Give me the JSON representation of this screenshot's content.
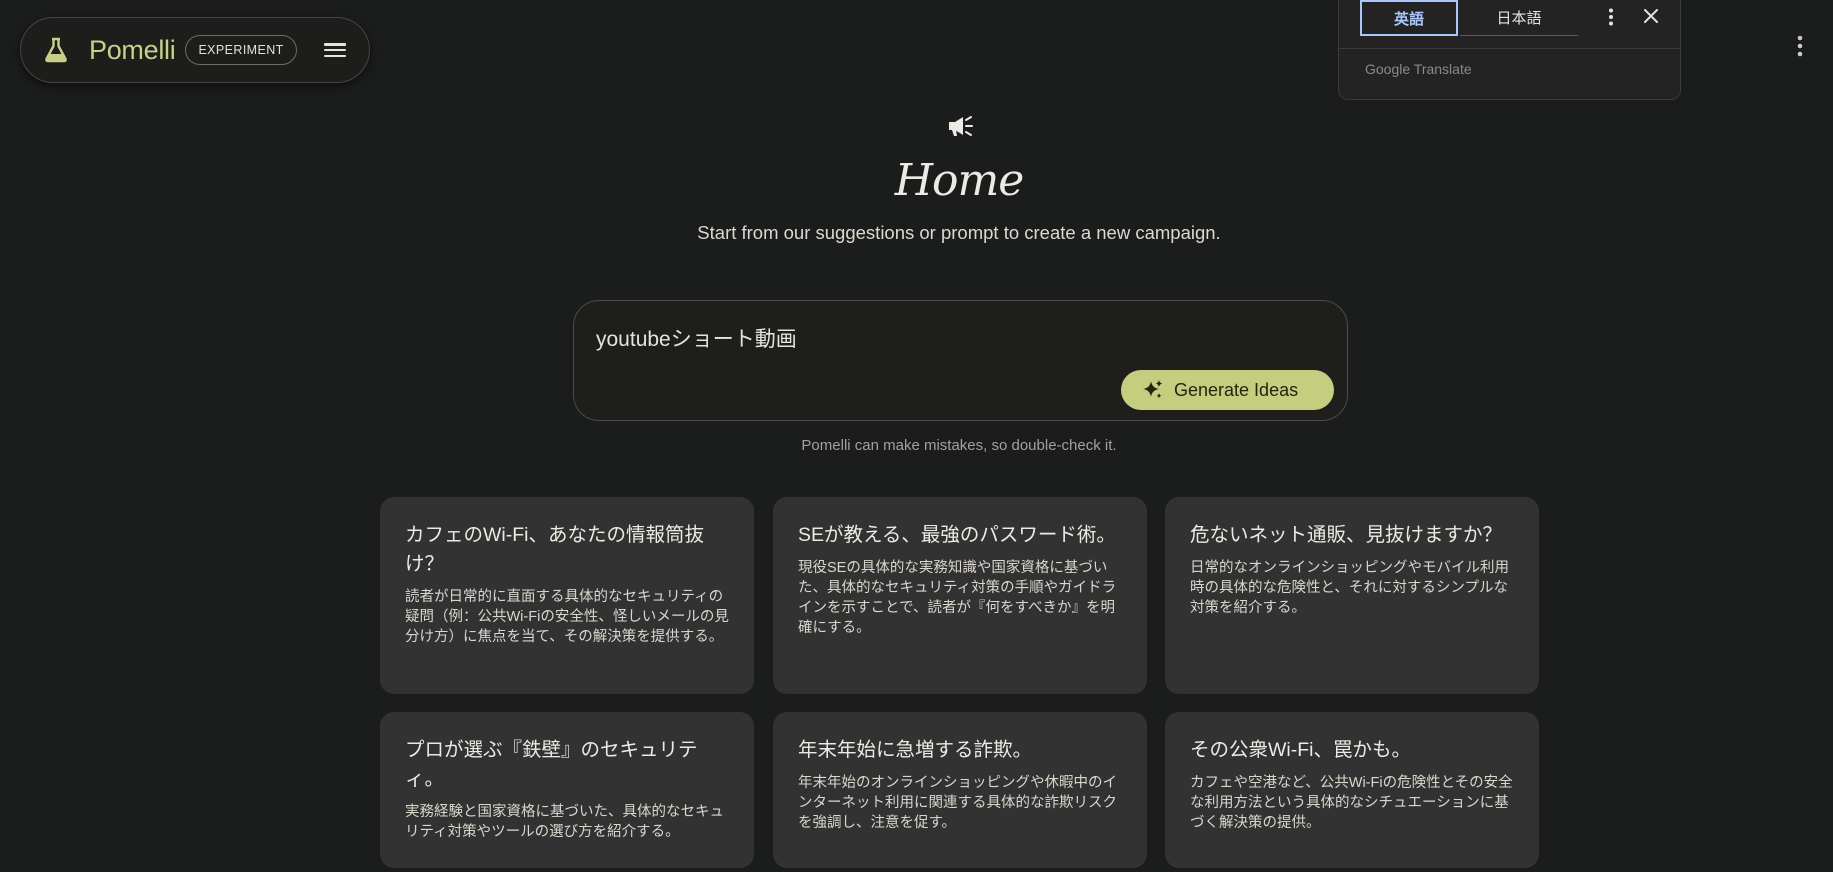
{
  "header": {
    "brand_name": "Pomelli",
    "badge": "EXPERIMENT",
    "icons": {
      "logo": "flask-icon",
      "menu": "hamburger-menu-icon",
      "overflow": "more-vertical-icon"
    }
  },
  "translate": {
    "source_lang": "英語",
    "target_lang": "日本語",
    "brand": "Google Translate",
    "colors": {
      "active": "#a8c7fa"
    }
  },
  "main": {
    "icon": "megaphone-icon",
    "title": "Home",
    "subtitle": "Start from our suggestions or prompt to create a new campaign.",
    "prompt_value": "youtubeショート動画",
    "generate_label": "Generate Ideas",
    "disclaimer": "Pomelli can make mistakes, so double-check it."
  },
  "cards": [
    {
      "title": "カフェのWi-Fi、あなたの情報筒抜け？",
      "desc": "読者が日常的に直面する具体的なセキュリティの疑問（例：公共Wi-Fiの安全性、怪しいメールの見分け方）に焦点を当て、その解決策を提供する。"
    },
    {
      "title": "SEが教える、最強のパスワード術。",
      "desc": "現役SEの具体的な実務知識や国家資格に基づいた、具体的なセキュリティ対策の手順やガイドラインを示すことで、読者が『何をすべきか』を明確にする。"
    },
    {
      "title": "危ないネット通販、見抜けますか？",
      "desc": "日常的なオンラインショッピングやモバイル利用時の具体的な危険性と、それに対するシンプルな対策を紹介する。"
    },
    {
      "title": "プロが選ぶ『鉄壁』のセキュリティ。",
      "desc": "実務経験と国家資格に基づいた、具体的なセキュリティ対策やツールの選び方を紹介する。"
    },
    {
      "title": "年末年始に急増する詐欺。",
      "desc": "年末年始のオンラインショッピングや休暇中のインターネット利用に関連する具体的な詐欺リスクを強調し、注意を促す。"
    },
    {
      "title": "その公衆Wi-Fi、罠かも。",
      "desc": "カフェや空港など、公共Wi-Fiの危険性とその安全な利用方法という具体的なシチュエーションに基づく解決策の提供。"
    }
  ],
  "colors": {
    "accent": "#c5cd7f",
    "background": "#1b1c1c",
    "card": "#323232"
  }
}
